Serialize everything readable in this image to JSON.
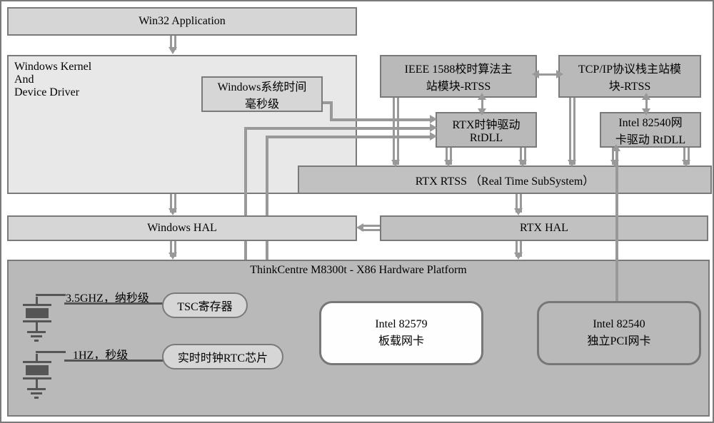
{
  "top": {
    "win32": "Win32 Application"
  },
  "kernel": {
    "title": "Windows Kernel\nAnd\nDevice Driver",
    "wintime_l1": "Windows系统时间",
    "wintime_l2": "毫秒级"
  },
  "mods": {
    "ieee1588_l1": "IEEE 1588校时算法主",
    "ieee1588_l2": "站模块-RTSS",
    "tcpip_l1": "TCP/IP协议栈主站模",
    "tcpip_l2": "块-RTSS",
    "rtxclock_l1": "RTX时钟驱动",
    "rtxclock_l2": "RtDLL",
    "nic_l1": "Intel 82540网",
    "nic_l2": "卡驱动 RtDLL",
    "rtss": "RTX RTSS （Real Time SubSystem）"
  },
  "hal": {
    "win": "Windows HAL",
    "rtx": "RTX HAL"
  },
  "hw": {
    "title": "ThinkCentre M8300t - X86 Hardware Platform",
    "osc1": "3.5GHZ，纳秒级",
    "osc2": "1HZ，秒级",
    "tsc": "TSC寄存器",
    "rtc": "实时时钟RTC芯片",
    "nic_onboard_l1": "Intel 82579",
    "nic_onboard_l2": "板载网卡",
    "nic_pci_l1": "Intel 82540",
    "nic_pci_l2": "独立PCI网卡"
  }
}
